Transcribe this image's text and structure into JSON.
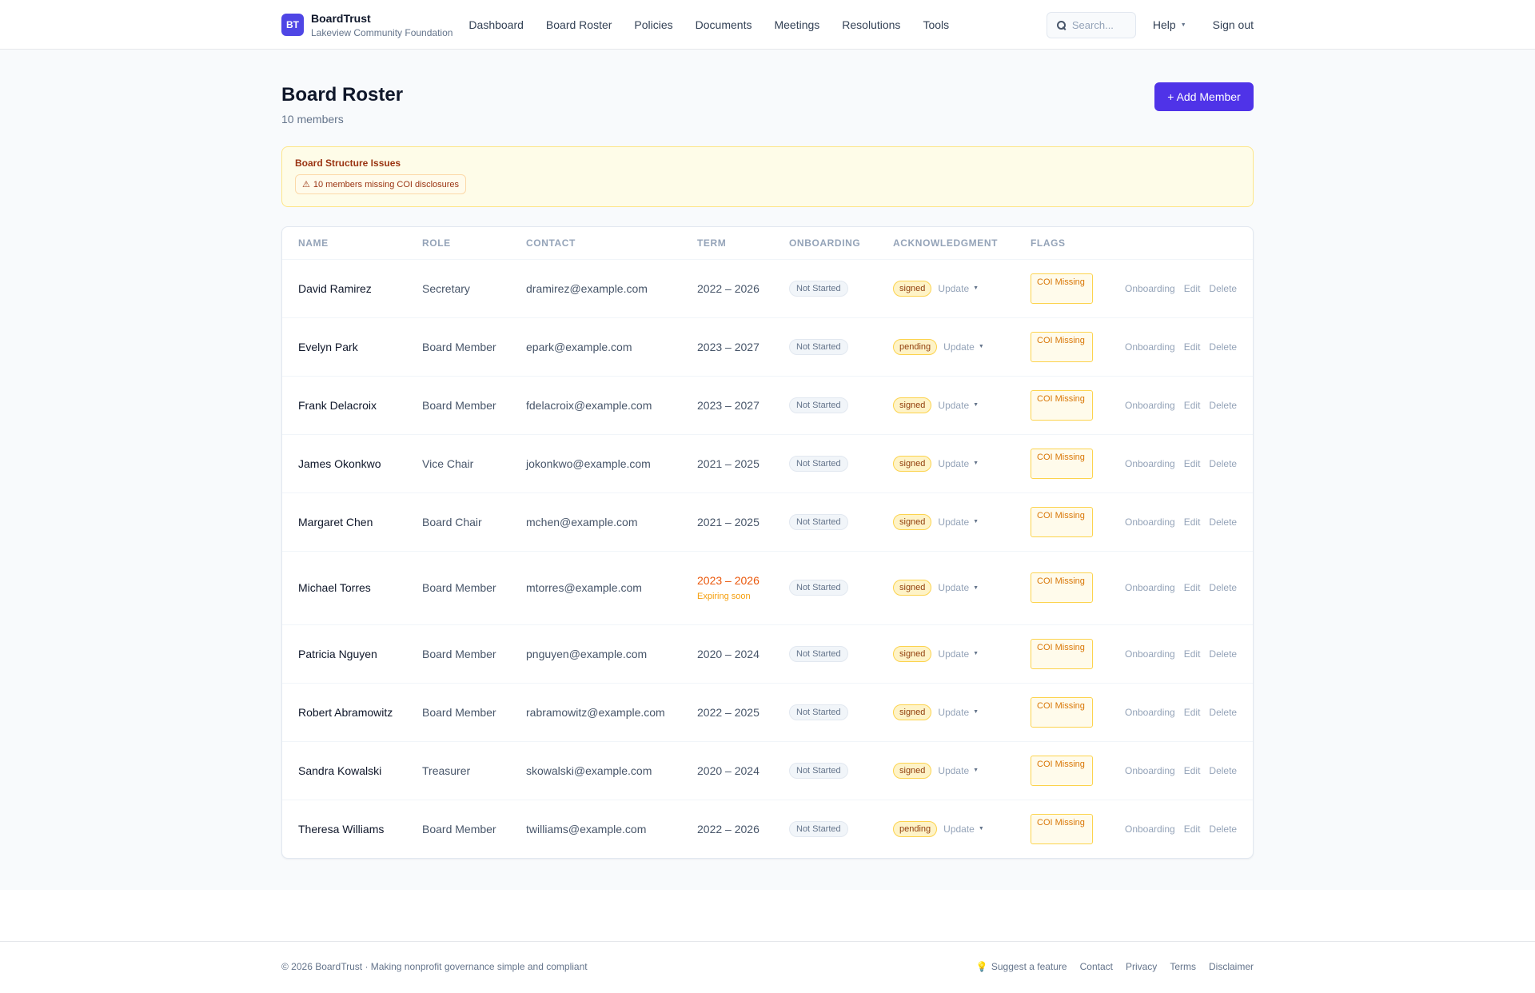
{
  "brand": {
    "logo": "BT",
    "name": "BoardTrust",
    "org": "Lakeview Community Foundation"
  },
  "nav": [
    "Dashboard",
    "Board Roster",
    "Policies",
    "Documents",
    "Meetings",
    "Resolutions",
    "Tools"
  ],
  "search": {
    "placeholder": "Search...",
    "icon": "search-icon"
  },
  "help": {
    "label": "Help"
  },
  "signout": {
    "label": "Sign out"
  },
  "page": {
    "title": "Board Roster",
    "subtitle": "10 members",
    "add_button": "+ Add Member"
  },
  "alert": {
    "title": "Board Structure Issues",
    "icon": "⚠",
    "issue": "10 members missing COI disclosures"
  },
  "table": {
    "headers": [
      "NAME",
      "ROLE",
      "CONTACT",
      "TERM",
      "ONBOARDING",
      "ACKNOWLEDGMENT",
      "FLAGS"
    ],
    "update_label": "Update",
    "actions": [
      "Onboarding",
      "Edit",
      "Delete"
    ],
    "rows": [
      {
        "name": "David Ramirez",
        "role": "Secretary",
        "email": "dramirez@example.com",
        "term": "2022 – 2026",
        "onboarding": "Not Started",
        "ack": "signed",
        "flag": "COI Missing"
      },
      {
        "name": "Evelyn Park",
        "role": "Board Member",
        "email": "epark@example.com",
        "term": "2023 – 2027",
        "onboarding": "Not Started",
        "ack": "pending",
        "flag": "COI Missing"
      },
      {
        "name": "Frank Delacroix",
        "role": "Board Member",
        "email": "fdelacroix@example.com",
        "term": "2023 – 2027",
        "onboarding": "Not Started",
        "ack": "signed",
        "flag": "COI Missing"
      },
      {
        "name": "James Okonkwo",
        "role": "Vice Chair",
        "email": "jokonkwo@example.com",
        "term": "2021 – 2025",
        "onboarding": "Not Started",
        "ack": "signed",
        "flag": "COI Missing"
      },
      {
        "name": "Margaret Chen",
        "role": "Board Chair",
        "email": "mchen@example.com",
        "term": "2021 – 2025",
        "onboarding": "Not Started",
        "ack": "signed",
        "flag": "COI Missing"
      },
      {
        "name": "Michael Torres",
        "role": "Board Member",
        "email": "mtorres@example.com",
        "term": "2023 – 2026",
        "term_note": "Expiring soon",
        "onboarding": "Not Started",
        "ack": "signed",
        "flag": "COI Missing"
      },
      {
        "name": "Patricia Nguyen",
        "role": "Board Member",
        "email": "pnguyen@example.com",
        "term": "2020 – 2024",
        "onboarding": "Not Started",
        "ack": "signed",
        "flag": "COI Missing"
      },
      {
        "name": "Robert Abramowitz",
        "role": "Board Member",
        "email": "rabramowitz@example.com",
        "term": "2022 – 2025",
        "onboarding": "Not Started",
        "ack": "signed",
        "flag": "COI Missing"
      },
      {
        "name": "Sandra Kowalski",
        "role": "Treasurer",
        "email": "skowalski@example.com",
        "term": "2020 – 2024",
        "onboarding": "Not Started",
        "ack": "signed",
        "flag": "COI Missing"
      },
      {
        "name": "Theresa Williams",
        "role": "Board Member",
        "email": "twilliams@example.com",
        "term": "2022 – 2026",
        "onboarding": "Not Started",
        "ack": "pending",
        "flag": "COI Missing"
      }
    ]
  },
  "footer": {
    "copyright": "© 2026 BoardTrust · Making nonprofit governance simple and compliant",
    "suggest": "Suggest a feature",
    "links": [
      "Contact",
      "Privacy",
      "Terms",
      "Disclaimer"
    ]
  },
  "colors": {
    "accent": "#4f33e8",
    "warning": "#d97706",
    "warning_bg": "#fffbeb"
  }
}
